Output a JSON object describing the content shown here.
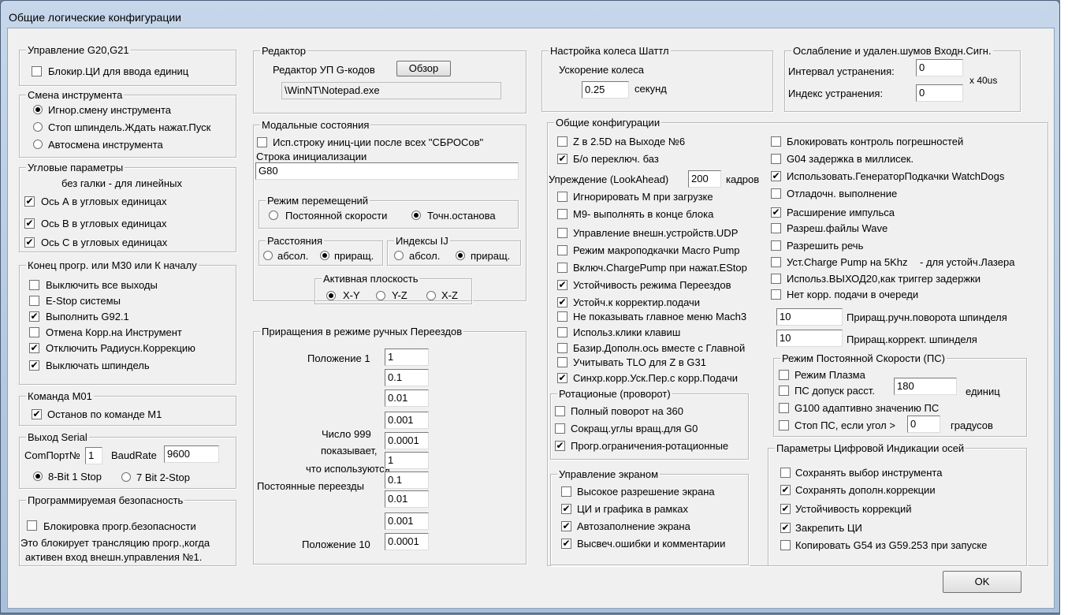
{
  "window": {
    "title": "Общие логические конфигурации"
  },
  "g20": {
    "legend": "Управление G20,G21",
    "block_units": {
      "label": "Блокир.ЦИ для ввода единиц",
      "checked": false
    }
  },
  "tool_change": {
    "legend": "Смена инструмента",
    "options": [
      {
        "label": "Игнор.смену инструмента",
        "selected": true
      },
      {
        "label": "Стоп шпиндель.Ждать нажат.Пуск",
        "selected": false
      },
      {
        "label": "Автосмена инструмента",
        "selected": false
      }
    ]
  },
  "angular": {
    "legend": "Угловые параметры",
    "note": "без галки - для линейных",
    "axes": [
      {
        "label": "Ось А в угловых единицах",
        "checked": true
      },
      {
        "label": "Ось В в угловых единицах",
        "checked": true
      },
      {
        "label": "Ось С в угловых единицах",
        "checked": true
      }
    ]
  },
  "program_end": {
    "legend": "Конец прогр. или M30 или К началу",
    "items": [
      {
        "label": "Выключить все выходы",
        "checked": false
      },
      {
        "label": "E-Stop системы",
        "checked": false
      },
      {
        "label": "Выполнить G92.1",
        "checked": true
      },
      {
        "label": "Отмена Корр.на Инструмент",
        "checked": false
      },
      {
        "label": "Отключить Радиусн.Коррекцию",
        "checked": true
      },
      {
        "label": "Выключать шпиндель",
        "checked": true
      }
    ]
  },
  "m01": {
    "legend": "Команда М01",
    "stop": {
      "label": "Останов по команде М1",
      "checked": true
    }
  },
  "serial": {
    "legend": "Выход Serial",
    "comport_label": "ComПорт№",
    "comport_value": "1",
    "baud_label": "BaudRate",
    "baud_value": "9600",
    "options": [
      {
        "label": "8-Bit 1 Stop",
        "selected": true
      },
      {
        "label": "7 Bit 2-Stop",
        "selected": false
      }
    ]
  },
  "safety": {
    "legend": "Программируемая безопасность",
    "lock": {
      "label": "Блокировка прогр.безопасности",
      "checked": false
    },
    "note1": "Это блокирует трансляцию прогр.,когда",
    "note2": "активен вход внешн.управления №1."
  },
  "editor": {
    "legend": "Редактор",
    "label": "Редактор УП G-кодов",
    "browse": "Обзор",
    "path": "\\WinNT\\Notepad.exe"
  },
  "modal": {
    "legend": "Модальные состояния",
    "use_init": {
      "label": "Исп.строку иниц-ции после всех \"СБРОСов\"",
      "checked": false
    },
    "init_label": "Строка инициализации",
    "init_value": "G80",
    "motion": {
      "legend": "Режим перемещений",
      "options": [
        {
          "label": "Постоянной скорости",
          "selected": false
        },
        {
          "label": "Точн.останова",
          "selected": true
        }
      ]
    },
    "distance": {
      "legend": "Расстояния",
      "options": [
        {
          "label": "абсол.",
          "selected": false
        },
        {
          "label": "приращ.",
          "selected": true
        }
      ]
    },
    "ij": {
      "legend": "Индексы IJ",
      "options": [
        {
          "label": "абсол.",
          "selected": false
        },
        {
          "label": "приращ.",
          "selected": true
        }
      ]
    },
    "plane": {
      "legend": "Активная плоскость",
      "options": [
        {
          "label": "X-Y",
          "selected": true
        },
        {
          "label": "Y-Z",
          "selected": false
        },
        {
          "label": "X-Z",
          "selected": false
        }
      ]
    }
  },
  "jog": {
    "legend": "Приращения в режиме ручных Переездов",
    "pos1": "Положение 1",
    "note1": "Число 999",
    "note2": "показывает,",
    "note3": "что используются",
    "note4": "Постоянные переезды",
    "pos10": "Положение 10",
    "values": [
      "1",
      "0.1",
      "0.01",
      "0.001",
      "0.0001",
      "1",
      "0.1",
      "0.01",
      "0.001",
      "0.0001"
    ]
  },
  "shuttle": {
    "legend": "Настройка колеса Шаттл",
    "accel_label": "Ускорение колеса",
    "accel_value": "0.25",
    "unit": "секунд"
  },
  "debounce": {
    "legend": "Ослабление и удален.шумов Входн.Сигн.",
    "interval_label": "Интервал устранения:",
    "interval_value": "0",
    "index_label": "Индекс устранения:",
    "index_value": "0",
    "unit": "x 40us"
  },
  "general": {
    "legend": "Общие конфигурации",
    "left_top": [
      {
        "label": "Z в 2.5D на Выходе №6",
        "checked": false
      },
      {
        "label": "Б/о переключ. баз",
        "checked": true
      }
    ],
    "lookahead_label": "Упреждение (LookAhead)",
    "lookahead_value": "200",
    "lookahead_unit": "кадров",
    "left_bottom": [
      {
        "label": "Игнорировать М при загрузке",
        "checked": false
      },
      {
        "label": "М9- выполнять в конце блока",
        "checked": false
      },
      {
        "label": "Управление внешн.устройств.UDP",
        "checked": false
      },
      {
        "label": "Режим макроподкачки Macro Pump",
        "checked": false
      },
      {
        "label": "Включ.ChargePump при нажат.EStop",
        "checked": false
      },
      {
        "label": "Устойчивость режима Переездов",
        "checked": true
      },
      {
        "label": "Устойч.к корректир.подачи",
        "checked": true
      },
      {
        "label": "Не показывать главное меню Mach3",
        "checked": false
      },
      {
        "label": "Использ.клики клавиш",
        "checked": false
      },
      {
        "label": "Базир.Дополн.ось вместе с Главной",
        "checked": false
      },
      {
        "label": "Учитывать TLO для Z в G31",
        "checked": false
      },
      {
        "label": "Синхр.корр.Уск.Пер.с корр.Подачи",
        "checked": true
      }
    ],
    "right": [
      {
        "label": "Блокировать контроль погрешностей",
        "checked": false
      },
      {
        "label": "G04 задержка в миллисек.",
        "checked": false
      },
      {
        "label": "Использовать.ГенераторПодкачки WatchDogs",
        "checked": true
      },
      {
        "label": "Отладочн. выполнение",
        "checked": false
      },
      {
        "label": "Расширение импульса",
        "checked": true
      },
      {
        "label": "Разреш.файлы Wave",
        "checked": false
      },
      {
        "label": "Разрешить речь",
        "checked": false
      },
      {
        "label": "Уст.Charge Pump на 5Khz",
        "checked": false,
        "suffix": "- для устойч.Лазера"
      },
      {
        "label": "Использ.ВЫХОД20,как триггер задержки",
        "checked": false
      },
      {
        "label": "Нет корр. подачи в очереди",
        "checked": false
      }
    ],
    "spindle_rot_value": "10",
    "spindle_rot_label": "Приращ.ручн.поворота шпинделя",
    "spindle_corr_value": "10",
    "spindle_corr_label": "Приращ.коррект. шпинделя"
  },
  "rotary": {
    "legend": "Ротационые (проворот)",
    "items": [
      {
        "label": "Полный поворот на 360",
        "checked": false
      },
      {
        "label": "Сокращ.углы вращ.для G0",
        "checked": false
      },
      {
        "label": "Прогр.ограничения-ротационные",
        "checked": true
      }
    ]
  },
  "screen": {
    "legend": "Управление экраном",
    "items": [
      {
        "label": "Высокое разрешение экрана",
        "checked": false
      },
      {
        "label": "ЦИ и графика в рамках",
        "checked": true
      },
      {
        "label": "Автозаполнение экрана",
        "checked": true
      },
      {
        "label": "Высвеч.ошибки и комментарии",
        "checked": true
      }
    ]
  },
  "css": {
    "legend": "Режим Постоянной Скорости (ПС)",
    "plasma": {
      "label": "Режим Плазма",
      "checked": false
    },
    "tolerance": {
      "label": "ПС допуск расст.",
      "checked": false,
      "value": "180",
      "unit": "единиц"
    },
    "g100": {
      "label": "G100 адаптивно значению ПС",
      "checked": false
    },
    "stop": {
      "label": "Стоп ПС, если угол >",
      "checked": false,
      "value": "0",
      "unit": "градусов"
    }
  },
  "dro": {
    "legend": "Параметры Цифровой Индикации осей",
    "items": [
      {
        "label": "Сохранять выбор инструмента",
        "checked": false
      },
      {
        "label": "Сохранять дополн.коррекции",
        "checked": true
      },
      {
        "label": "Устойчивость коррекций",
        "checked": true
      },
      {
        "label": "Закрепить ЦИ",
        "checked": true
      },
      {
        "label": "Копировать G54 из G59.253 при запуске",
        "checked": false
      }
    ]
  },
  "ok_label": "OK",
  "background": {
    "fragment": "ие"
  }
}
